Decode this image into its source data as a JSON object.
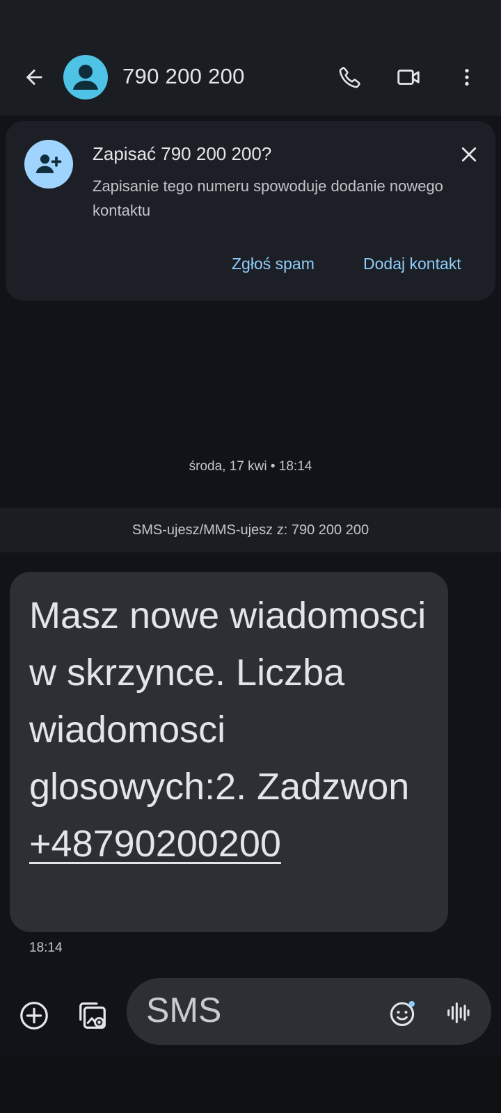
{
  "header": {
    "title": "790 200 200",
    "icons": {
      "back": "arrow-left-icon",
      "avatar": "person-icon",
      "call": "phone-icon",
      "video": "videocam-icon",
      "more": "more-vert-icon"
    }
  },
  "save_card": {
    "title": "Zapisać 790 200 200?",
    "description": "Zapisanie tego numeru spowoduje dodanie nowego kontaktu",
    "report_spam_label": "Zgłoś spam",
    "add_contact_label": "Dodaj kontakt",
    "icons": {
      "avatar": "person-add-icon",
      "close": "close-icon"
    }
  },
  "conversation": {
    "date_separator": "środa, 17 kwi • 18:14",
    "via_banner": "SMS-ujesz/MMS-ujesz z: 790 200 200",
    "messages": [
      {
        "text": "Masz nowe wiadomosci w skrzynce. Liczba wiadomosci glosowych:2. Zadzwon ",
        "link": "+48790200200",
        "time": "18:14"
      }
    ]
  },
  "composer": {
    "placeholder": "SMS",
    "icons": {
      "add": "add-circle-icon",
      "gallery": "gallery-icon",
      "emoji": "emoji-icon",
      "voice": "voice-waveform-icon"
    }
  },
  "colors": {
    "accent_link": "#8ecdfb",
    "avatar_header": "#4fc3e6",
    "avatar_card": "#9fd4ff",
    "bubble": "#2c3035",
    "background": "#111318"
  }
}
